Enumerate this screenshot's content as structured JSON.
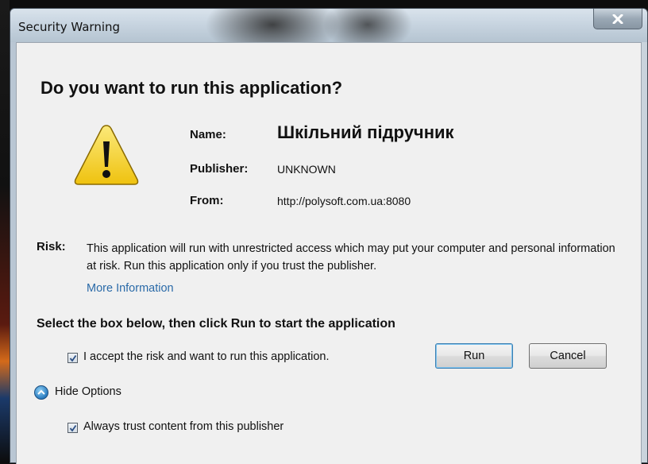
{
  "window": {
    "title": "Security Warning",
    "close_glyph": "x"
  },
  "dialog": {
    "heading": "Do you want to run this application?",
    "icon": "warning-icon",
    "name_label": "Name:",
    "name_value": "Шкільний підручник",
    "publisher_label": "Publisher:",
    "publisher_value": "UNKNOWN",
    "from_label": "From:",
    "from_value": "http://polysoft.com.ua:8080",
    "risk_label": "Risk:",
    "risk_text": "This application will run with unrestricted access which may put your computer and personal information at risk. Run this application only if you trust the publisher.",
    "more_info": "More Information",
    "instruction": "Select the box below, then click Run to start the application",
    "accept_label": "I accept the risk and want to run this application.",
    "accept_checked": true,
    "run_label": "Run",
    "cancel_label": "Cancel",
    "options_toggle_label": "Hide Options",
    "options_toggle_icon": "chevron-up-icon",
    "trust_label": "Always trust content from this publisher",
    "trust_checked": true
  },
  "colors": {
    "link": "#2a6aa8",
    "warning_fill": "#f5d21d",
    "dialog_bg": "#f0f0f0"
  }
}
